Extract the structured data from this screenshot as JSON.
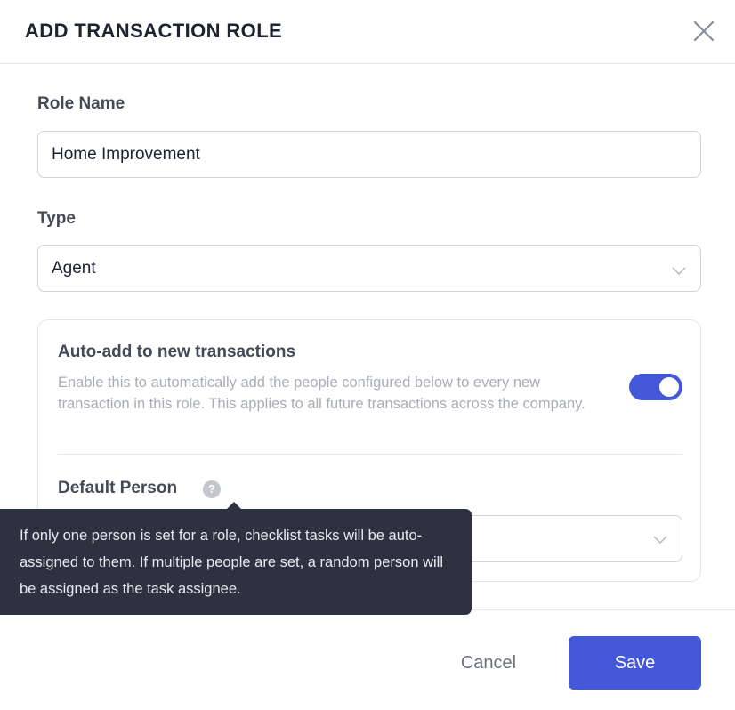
{
  "modal": {
    "title": "ADD TRANSACTION ROLE",
    "close_icon": "close-icon"
  },
  "role_name": {
    "label": "Role Name",
    "value": "Home Improvement"
  },
  "type": {
    "label": "Type",
    "value": "Agent",
    "icon": "chevron-down-icon"
  },
  "auto_add": {
    "title": "Auto-add to new transactions",
    "description": "Enable this to automatically add the people configured below to every new transaction in this role. This applies to all future transactions across the company.",
    "enabled": true
  },
  "default_person": {
    "label": "Default Person",
    "help_glyph": "?",
    "value": ""
  },
  "tooltip": {
    "text": "If only one person is set for a role, checklist tasks will be auto-assigned to them. If multiple people are set, a random person will be assigned as the task assignee."
  },
  "footer": {
    "cancel_label": "Cancel",
    "save_label": "Save"
  },
  "colors": {
    "primary": "#4557d9",
    "tooltip_bg": "#2e3140",
    "muted_text": "#a9adb6"
  }
}
